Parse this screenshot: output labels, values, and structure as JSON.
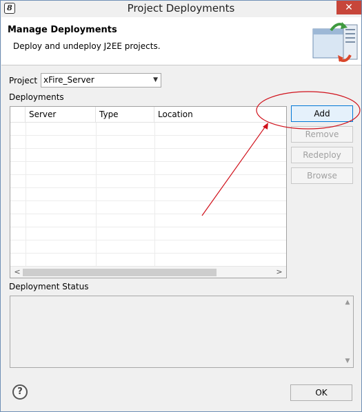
{
  "window": {
    "title": "Project Deployments"
  },
  "header": {
    "title": "Manage Deployments",
    "description": "Deploy and undeploy J2EE projects."
  },
  "project": {
    "label": "Project",
    "selected": "xFire_Server"
  },
  "deployments": {
    "label": "Deployments",
    "columns": [
      "",
      "Server",
      "Type",
      "Location"
    ],
    "rows": []
  },
  "buttons": {
    "add": "Add",
    "remove": "Remove",
    "redeploy": "Redeploy",
    "browse": "Browse",
    "ok": "OK"
  },
  "status": {
    "label": "Deployment Status",
    "text": ""
  },
  "icons": {
    "help": "?",
    "close": "✕",
    "app": "8"
  },
  "colors": {
    "annotation": "#d0101a",
    "accent": "#0078d7"
  }
}
